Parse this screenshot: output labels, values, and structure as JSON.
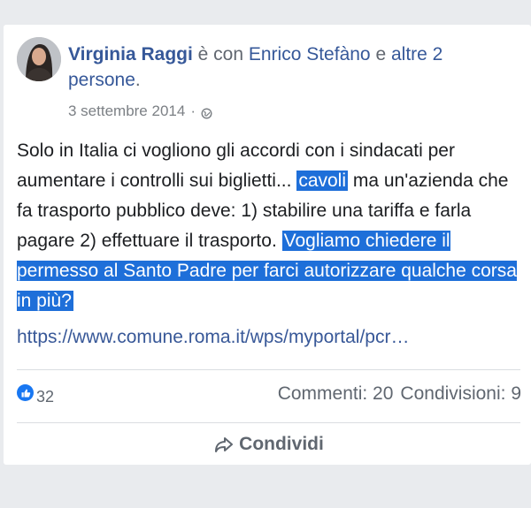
{
  "post": {
    "author": "Virginia Raggi",
    "with_text": " è con ",
    "tagged_person": "Enrico Stefàno",
    "and_text": " e ",
    "others_link": "altre 2 persone",
    "period": ".",
    "date": "3 settembre 2014",
    "date_separator": "·",
    "text_part1": "Solo in Italia ci vogliono gli accordi con i sindacati per aumentare i controlli sui biglietti... ",
    "highlight1": "cavoli",
    "text_part2": " ma un'azienda che fa trasporto pubblico deve: 1) stabilire una tariffa e farla pagare 2) effettuare il trasporto. ",
    "highlight2": "Vogliamo chiedere il permesso al Santo Padre per farci autorizzare qualche corsa in più?",
    "link_url": "https://www.comune.roma.it/wps/myportal/pcr…"
  },
  "footer": {
    "like_count": "32",
    "comments": "Commenti: 20",
    "shares": "Condivisioni: 9",
    "share_label": "Condividi"
  },
  "colors": {
    "link": "#365899",
    "highlight": "#1e6fd9",
    "like": "#1877f2"
  },
  "icons": [
    "avatar",
    "globe-icon",
    "like-icon",
    "share-icon"
  ]
}
